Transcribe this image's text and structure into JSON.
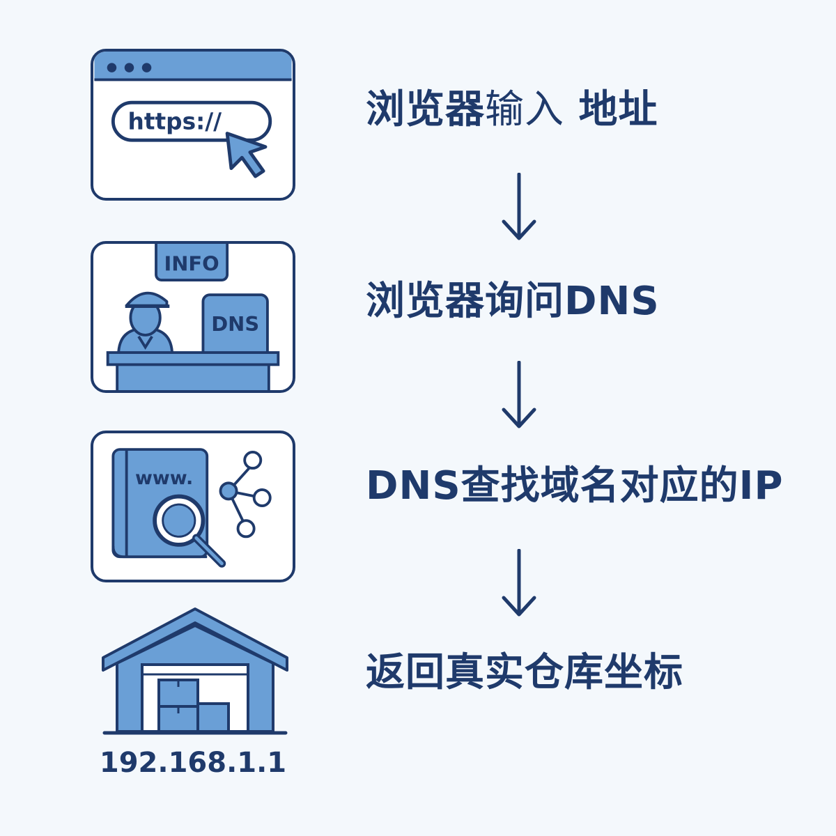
{
  "colors": {
    "navy": "#1f3a6b",
    "blue": "#6a9fd6",
    "background": "#f4f8fc",
    "white": "#ffffff"
  },
  "steps": [
    {
      "icon": "browser-window-icon",
      "url_text": "https://",
      "label_bold_1": "浏览器",
      "label_light": "输入",
      "label_bold_2": "地址"
    },
    {
      "icon": "dns-info-desk-icon",
      "info_sign": "INFO",
      "dns_sign": "DNS",
      "label": "浏览器询问DNS"
    },
    {
      "icon": "domain-lookup-book-icon",
      "book_text": "www.",
      "label": "DNS查找域名对应的IP"
    },
    {
      "icon": "warehouse-icon",
      "ip": "192.168.1.1",
      "label": "返回真实仓库坐标"
    }
  ],
  "arrows": [
    "down-arrow-icon",
    "down-arrow-icon",
    "down-arrow-icon"
  ]
}
